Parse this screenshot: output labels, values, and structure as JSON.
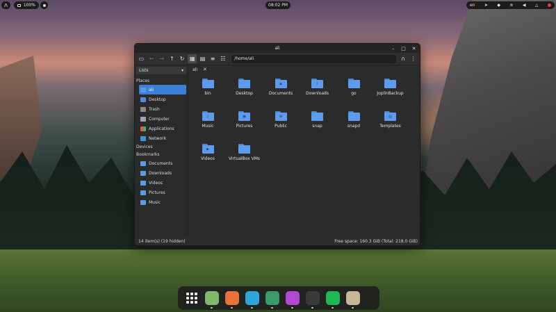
{
  "topbar": {
    "battery_percent": "100%",
    "clock": "08:02 PM",
    "keyboard_layout": "en"
  },
  "window": {
    "title": "ali",
    "path": "/home/ali",
    "tab_label": "ali",
    "status_left": "14 item(s) (19 hidden)",
    "status_right": "Free space: 160.3 GiB (Total: 218.0 GiB)"
  },
  "sidebar": {
    "view_select": "Lists",
    "places_header": "Places",
    "places": [
      {
        "label": "ali",
        "icon": "home-folder-icon"
      },
      {
        "label": "Desktop",
        "icon": "desktop-icon"
      },
      {
        "label": "Trash",
        "icon": "trash-icon"
      },
      {
        "label": "Computer",
        "icon": "computer-icon"
      },
      {
        "label": "Applications",
        "icon": "applications-icon"
      },
      {
        "label": "Network",
        "icon": "network-icon"
      }
    ],
    "devices_header": "Devices",
    "bookmarks_header": "Bookmarks",
    "bookmarks": [
      {
        "label": "Documents"
      },
      {
        "label": "Downloads"
      },
      {
        "label": "Videos"
      },
      {
        "label": "Pictures"
      },
      {
        "label": "Music"
      }
    ]
  },
  "files": [
    {
      "label": "bin",
      "emblem": ""
    },
    {
      "label": "Desktop",
      "emblem": ""
    },
    {
      "label": "Documents",
      "emblem": "▪"
    },
    {
      "label": "Downloads",
      "emblem": "⇩"
    },
    {
      "label": "go",
      "emblem": ""
    },
    {
      "label": "JoplinBackup",
      "emblem": ""
    },
    {
      "label": "Music",
      "emblem": "♪"
    },
    {
      "label": "Pictures",
      "emblem": "▣"
    },
    {
      "label": "Public",
      "emblem": "⊞"
    },
    {
      "label": "snap",
      "emblem": ""
    },
    {
      "label": "snapd",
      "emblem": ""
    },
    {
      "label": "Templates",
      "emblem": "▤"
    },
    {
      "label": "Videos",
      "emblem": "▶"
    },
    {
      "label": "VirtualBox VMs",
      "emblem": ""
    }
  ],
  "dock": [
    {
      "name": "app-grid",
      "color": "#1e1e1e"
    },
    {
      "name": "files",
      "color": "#7fb86b"
    },
    {
      "name": "firefox",
      "color": "#e8733a"
    },
    {
      "name": "telegram",
      "color": "#2ea6da"
    },
    {
      "name": "gnome-tweaks",
      "color": "#3a9a6a"
    },
    {
      "name": "pomodoro",
      "color": "#b04ad0"
    },
    {
      "name": "terminal",
      "color": "#3a3a3a"
    },
    {
      "name": "spotify",
      "color": "#1db954"
    },
    {
      "name": "xournal",
      "color": "#c8b89a"
    }
  ]
}
